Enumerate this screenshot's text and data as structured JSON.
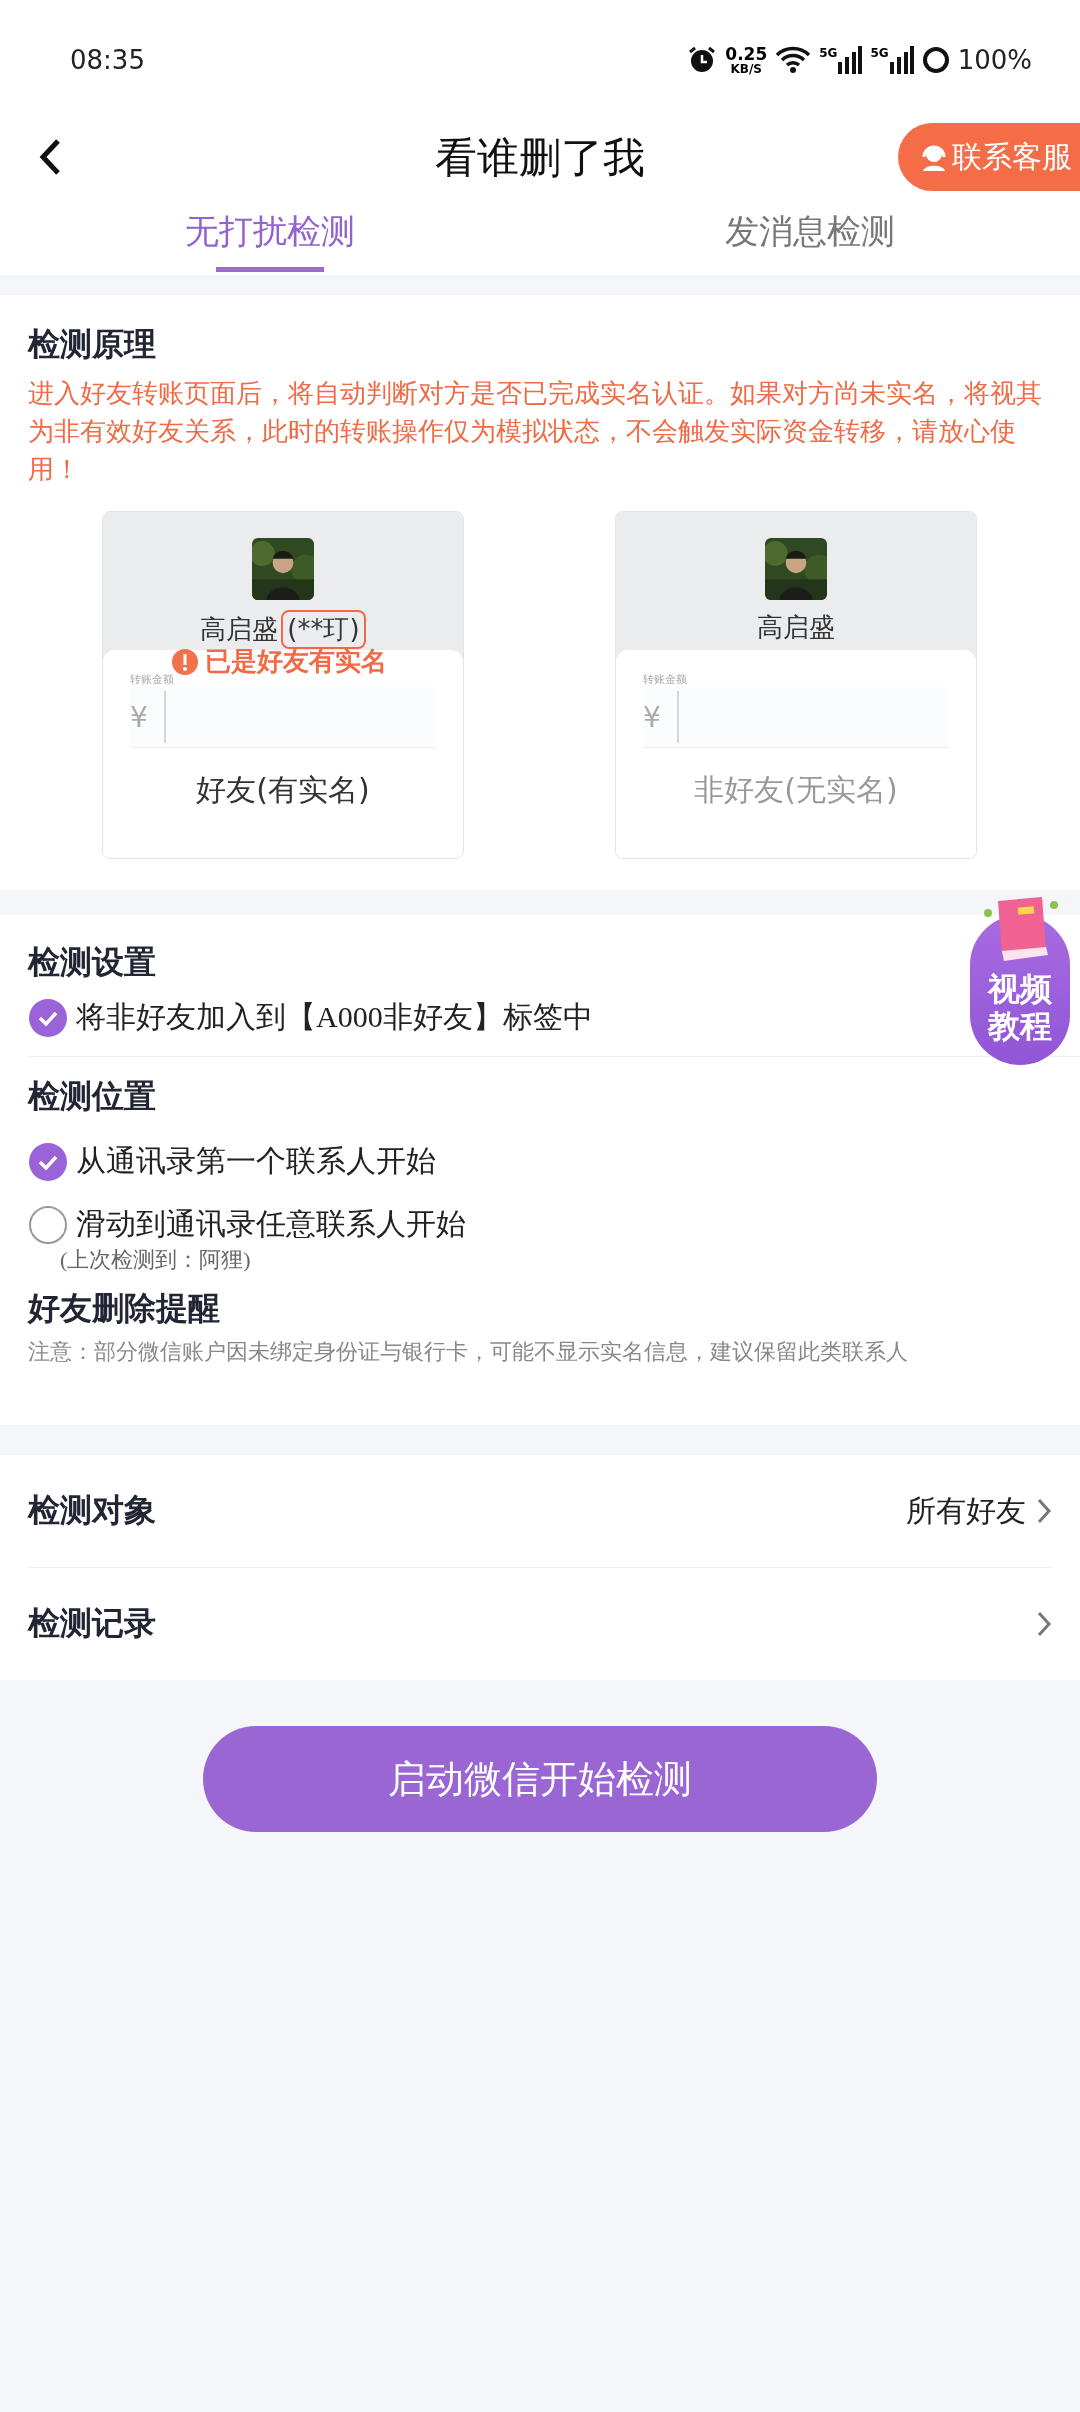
{
  "status_bar": {
    "time": "08:35",
    "speed": "0.25",
    "speed_unit": "KB/S",
    "network_1": "5G",
    "network_2": "5G",
    "battery": "100%"
  },
  "header": {
    "title": "看谁删了我",
    "service_button": "联系客服"
  },
  "tabs": [
    {
      "label": "无打扰检测",
      "selected": true
    },
    {
      "label": "发消息检测",
      "selected": false
    }
  ],
  "principle": {
    "heading": "检测原理",
    "text": "进入好友转账页面后，将自动判断对方是否已完成实名认证。如果对方尚未实名，将视其为非有效好友关系，此时的转账操作仅为模拟状态，不会触发实际资金转移，请放心使用！",
    "cards": [
      {
        "kind": "friend",
        "name": "高启盛",
        "masked_name": "(**玎)",
        "warning": "已是好友有实名",
        "amount_label": "转账金额",
        "currency": "¥",
        "caption": "好友(有实名)"
      },
      {
        "kind": "stranger",
        "name": "高启盛",
        "amount_label": "转账金额",
        "currency": "¥",
        "caption": "非好友(无实名)"
      }
    ]
  },
  "settings": {
    "heading": "检测设置",
    "options": [
      {
        "label": "将非好友加入到【A000非好友】标签中",
        "checked": true
      }
    ]
  },
  "video_badge": "视频教程",
  "position": {
    "heading": "检测位置",
    "options": [
      {
        "label": "从通讯录第一个联系人开始",
        "selected": true
      },
      {
        "label": "滑动到通讯录任意联系人开始",
        "selected": false,
        "note": "(上次检测到：阿狸)"
      }
    ]
  },
  "reminder": {
    "heading": "好友删除提醒",
    "note": "注意：部分微信账户因未绑定身份证与银行卡，可能不显示实名信息，建议保留此类联系人"
  },
  "menu": [
    {
      "label": "检测对象",
      "value": "所有好友"
    },
    {
      "label": "检测记录"
    }
  ],
  "start_button": "启动微信开始检测"
}
